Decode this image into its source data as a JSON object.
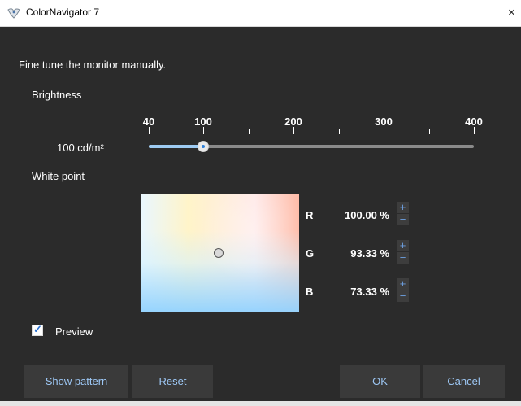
{
  "window": {
    "title": "ColorNavigator 7",
    "close_label": "×"
  },
  "content": {
    "instruction": "Fine tune the monitor manually.",
    "brightness": {
      "label": "Brightness",
      "value": "100 cd/m²",
      "scale_labels": [
        "40",
        "100",
        "200",
        "300",
        "400"
      ],
      "min": 40,
      "max": 400,
      "current": 100
    },
    "white_point": {
      "label": "White point",
      "channels": [
        {
          "name": "R",
          "value": "100.00 %"
        },
        {
          "name": "G",
          "value": "93.33 %"
        },
        {
          "name": "B",
          "value": "73.33 %"
        }
      ],
      "increment_symbol": "+",
      "decrement_symbol": "−"
    },
    "preview": {
      "label": "Preview",
      "checked": true
    }
  },
  "buttons": {
    "show_pattern": "Show pattern",
    "reset": "Reset",
    "ok": "OK",
    "cancel": "Cancel"
  },
  "icons": {
    "app": "colornavigator-app-icon",
    "check": "check-icon",
    "close": "close-icon"
  },
  "colors": {
    "background": "#2b2b2b",
    "accent": "#9dc7f4",
    "titlebar": "#ffffff"
  }
}
